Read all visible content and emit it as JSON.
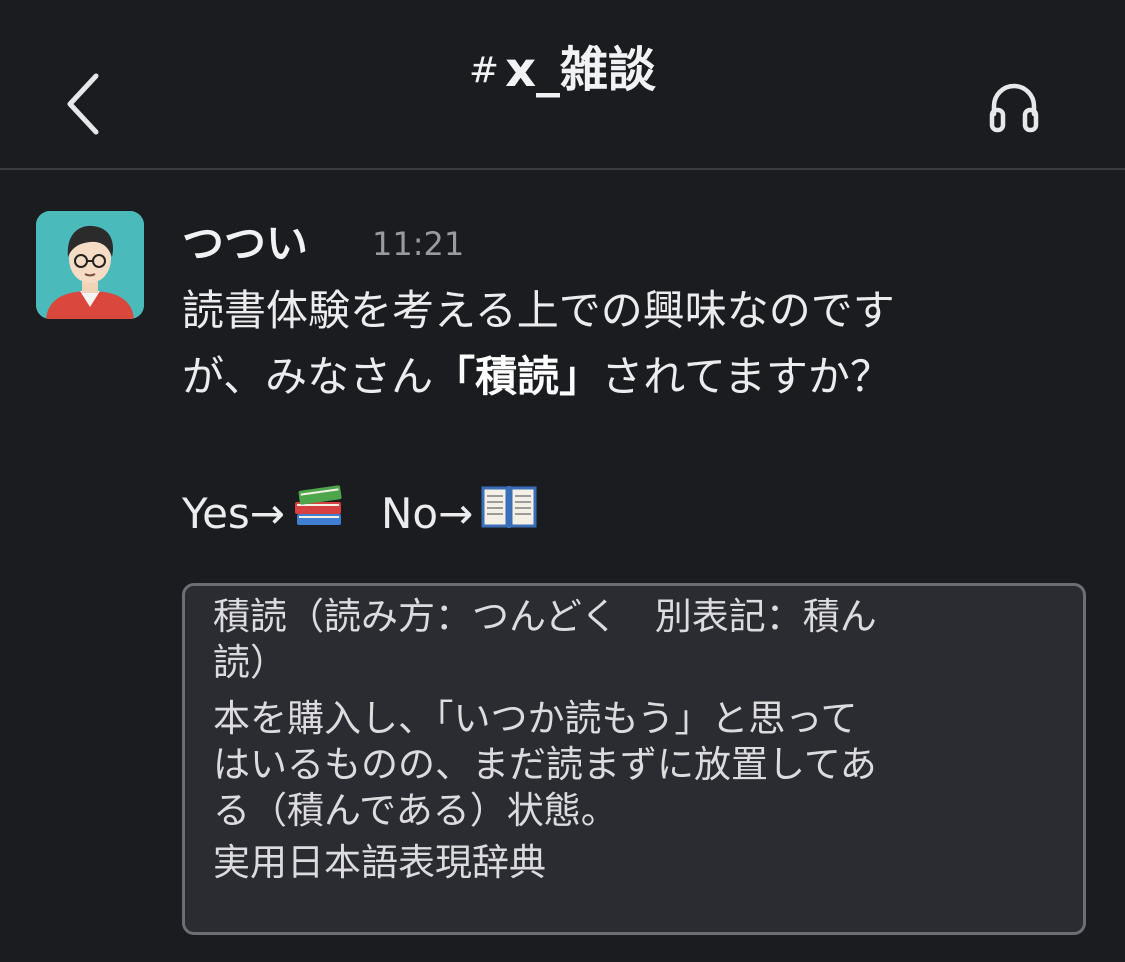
{
  "header": {
    "channel_prefix": "#",
    "channel_name": "x_雑談",
    "back_icon": "chevron-left-icon",
    "huddle_icon": "headphones-icon"
  },
  "message": {
    "author": "つつい",
    "time": "11:21",
    "line1": "読書体験を考える上での興味なのです",
    "line2_before": "が、みなさん",
    "line2_bold": "「積読」",
    "line2_after": "されてますか？",
    "yes_label": "Yes→",
    "yes_emoji": "📚",
    "no_label": "No→",
    "no_emoji": "📖"
  },
  "attachment": {
    "heading_line1": "積読（読み方：つんどく　別表記：積ん",
    "heading_line2": "読）",
    "definition_line1": "本を購入し、「いつか読もう」と思って",
    "definition_line2": "はいるものの、まだ読まずに放置してあ",
    "definition_line3": "る（積んである）状態。",
    "source": "実用日本語表現辞典"
  },
  "colors": {
    "background": "#1b1c20",
    "divider": "#3b3c41",
    "avatar_bg": "#4bbabb",
    "attachment_bg": "#2b2c31",
    "attachment_border": "#6d6e73"
  }
}
